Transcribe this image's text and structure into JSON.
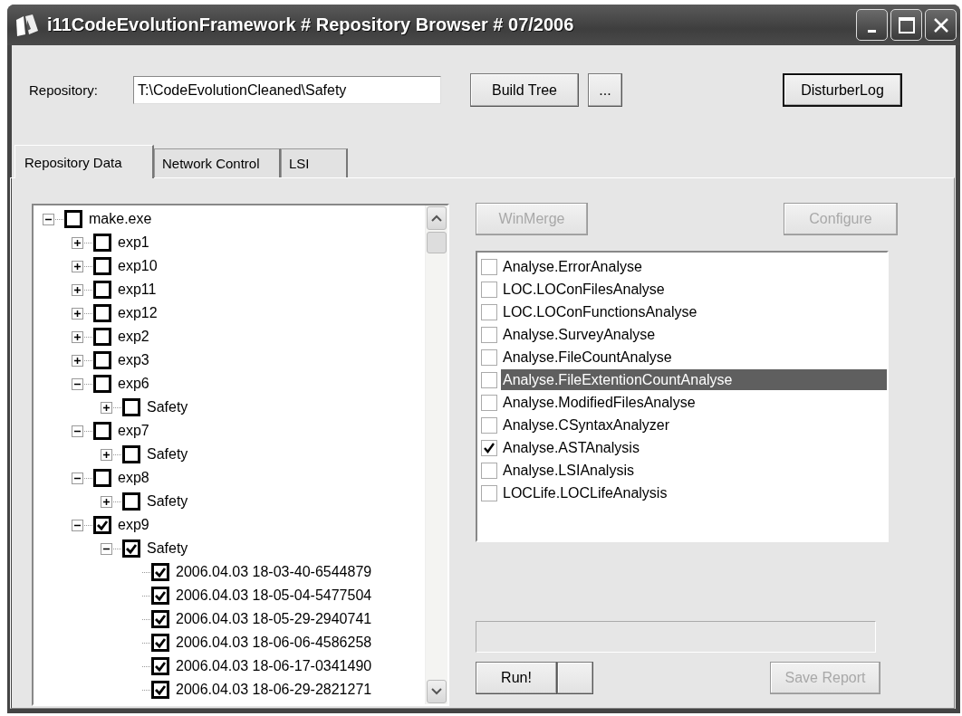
{
  "window": {
    "title": "i11CodeEvolutionFramework # Repository Browser # 07/2006"
  },
  "repository": {
    "label": "Repository:",
    "value": "T:\\CodeEvolutionCleaned\\Safety"
  },
  "top_buttons": [
    {
      "label": "Build Tree",
      "disabled": false,
      "default": false
    },
    {
      "label": "...",
      "disabled": false,
      "default": false
    },
    {
      "label": "DisturberLog",
      "disabled": false,
      "default": true
    }
  ],
  "tabs": [
    {
      "label": "Repository Data",
      "selected": true
    },
    {
      "label": "Network Control",
      "selected": false
    },
    {
      "label": "LSI",
      "selected": false
    }
  ],
  "tree": [
    {
      "label": "make.exe",
      "checked": false,
      "expanded": true,
      "children": [
        {
          "label": "exp1",
          "checked": false,
          "expanded": false
        },
        {
          "label": "exp10",
          "checked": false,
          "expanded": false
        },
        {
          "label": "exp11",
          "checked": false,
          "expanded": false
        },
        {
          "label": "exp12",
          "checked": false,
          "expanded": false
        },
        {
          "label": "exp2",
          "checked": false,
          "expanded": false
        },
        {
          "label": "exp3",
          "checked": false,
          "expanded": false
        },
        {
          "label": "exp6",
          "checked": false,
          "expanded": true,
          "children": [
            {
              "label": "Safety",
              "checked": false,
              "expanded": false
            }
          ]
        },
        {
          "label": "exp7",
          "checked": false,
          "expanded": true,
          "children": [
            {
              "label": "Safety",
              "checked": false,
              "expanded": false
            }
          ]
        },
        {
          "label": "exp8",
          "checked": false,
          "expanded": true,
          "children": [
            {
              "label": "Safety",
              "checked": false,
              "expanded": false
            }
          ]
        },
        {
          "label": "exp9",
          "checked": true,
          "expanded": true,
          "children": [
            {
              "label": "Safety",
              "checked": true,
              "expanded": true,
              "children": [
                {
                  "label": "2006.04.03 18-03-40-6544879",
                  "checked": true
                },
                {
                  "label": "2006.04.03 18-05-04-5477504",
                  "checked": true
                },
                {
                  "label": "2006.04.03 18-05-29-2940741",
                  "checked": true
                },
                {
                  "label": "2006.04.03 18-06-06-4586258",
                  "checked": true
                },
                {
                  "label": "2006.04.03 18-06-17-0341490",
                  "checked": true
                },
                {
                  "label": "2006.04.03 18-06-29-2821271",
                  "checked": true
                }
              ]
            }
          ]
        }
      ]
    }
  ],
  "side_buttons": [
    {
      "label": "WinMerge",
      "disabled": true,
      "default": false
    },
    {
      "label": "Configure",
      "disabled": true,
      "default": false
    }
  ],
  "analyses": [
    {
      "label": "Analyse.ErrorAnalyse",
      "checked": false,
      "selected": false
    },
    {
      "label": "LOC.LOConFilesAnalyse",
      "checked": false,
      "selected": false
    },
    {
      "label": "LOC.LOConFunctionsAnalyse",
      "checked": false,
      "selected": false
    },
    {
      "label": "Analyse.SurveyAnalyse",
      "checked": false,
      "selected": false
    },
    {
      "label": "Analyse.FileCountAnalyse",
      "checked": false,
      "selected": false
    },
    {
      "label": "Analyse.FileExtentionCountAnalyse",
      "checked": false,
      "selected": true
    },
    {
      "label": "Analyse.ModifiedFilesAnalyse",
      "checked": false,
      "selected": false
    },
    {
      "label": "Analyse.CSyntaxAnalyzer",
      "checked": false,
      "selected": false
    },
    {
      "label": "Analyse.ASTAnalysis",
      "checked": true,
      "selected": false
    },
    {
      "label": "Analyse.LSIAnalysis",
      "checked": false,
      "selected": false
    },
    {
      "label": "LOCLife.LOCLifeAnalysis",
      "checked": false,
      "selected": false
    }
  ],
  "progress": {
    "level": 0
  },
  "bottom_buttons": [
    {
      "label": "Run!",
      "disabled": false,
      "default": false
    },
    {
      "label": "Save Report",
      "disabled": true,
      "default": false
    }
  ]
}
